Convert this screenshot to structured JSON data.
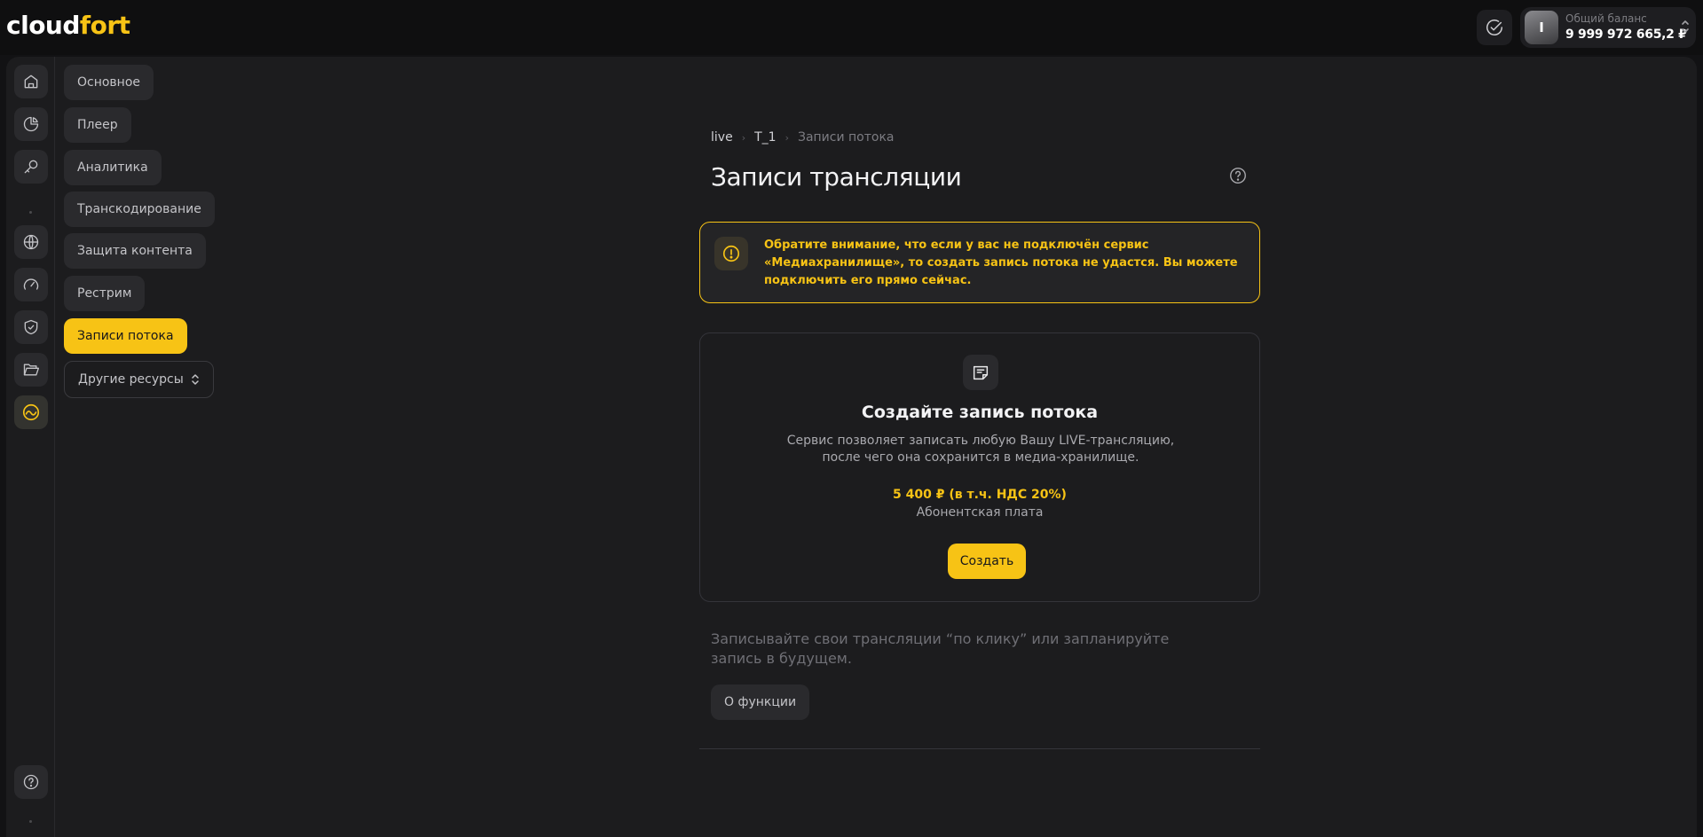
{
  "app": {
    "logo_part1": "cloud",
    "logo_part2": "fort",
    "accent_color": "#f7c315"
  },
  "header": {
    "balance_label": "Общий баланс",
    "balance_value": "9 999 972 665,2 ₽",
    "avatar_letter": "I"
  },
  "rail": {
    "items": [
      "home-icon",
      "chart-pie-icon",
      "key-icon",
      "globe-icon",
      "speedometer-icon",
      "shield-check-icon",
      "folder-open-icon",
      "stream-icon"
    ],
    "bottom": "help-icon"
  },
  "subnav": {
    "items": [
      {
        "label": "Основное"
      },
      {
        "label": "Плеер"
      },
      {
        "label": "Аналитика"
      },
      {
        "label": "Транскодирование"
      },
      {
        "label": "Защита контента"
      },
      {
        "label": "Рестрим"
      },
      {
        "label": "Записи потока"
      }
    ],
    "active_index": 6,
    "other": "Другие ресурсы"
  },
  "breadcrumb": {
    "items": [
      "live",
      "T_1",
      "Записи потока"
    ]
  },
  "page": {
    "title": "Записи трансляции"
  },
  "warning": {
    "text": "Обратите внимание, что если у вас не подключён сервис «Медиахранилище», то создать запись потока не удастся. Вы можете подключить его прямо сейчас."
  },
  "card": {
    "title": "Создайте запись потока",
    "description": "Сервис позволяет записать любую Вашу LIVE-трансляцию, после чего она сохранится в медиа-хранилище.",
    "price": "5 400 ₽ (в т.ч. НДС 20%)",
    "price_label": "Абонентская плата",
    "button": "Создать"
  },
  "promo": {
    "text": "Записывайте свои трансляции “по клику” или запланируйте запись в будущем.",
    "button": "О функции"
  }
}
